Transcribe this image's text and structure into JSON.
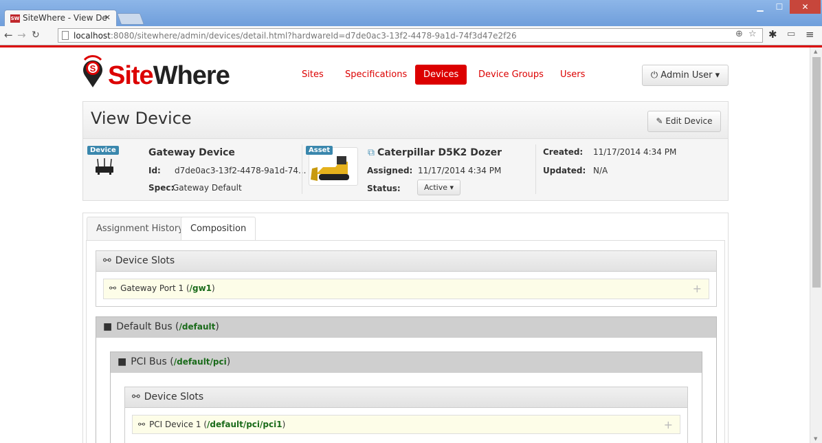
{
  "browser": {
    "tab_title": "SiteWhere - View De",
    "favicon_text": "SW",
    "url_host": "localhost",
    "url_rest": ":8080/sitewhere/admin/devices/detail.html?hardwareId=d7de0ac3-13f2-4478-9a1d-74f3d47e2f26"
  },
  "logo": {
    "site": "Site",
    "where": "Where"
  },
  "nav": {
    "items": [
      {
        "label": "Sites"
      },
      {
        "label": "Specifications"
      },
      {
        "label": "Devices"
      },
      {
        "label": "Device Groups"
      },
      {
        "label": "Users"
      }
    ],
    "active": "Devices",
    "user_label": "Admin User"
  },
  "view": {
    "title": "View Device",
    "edit_label": "Edit Device"
  },
  "device": {
    "badge": "Device",
    "name": "Gateway Device",
    "id_label": "Id:",
    "id_value": "d7de0ac3-13f2-4478-9a1d-74...",
    "spec_label": "Spec:",
    "spec_value": "Gateway Default"
  },
  "asset": {
    "badge": "Asset",
    "name": "Caterpillar D5K2 Dozer",
    "assigned_label": "Assigned:",
    "assigned_value": "11/17/2014 4:34 PM",
    "status_label": "Status:",
    "status_value": "Active"
  },
  "dates": {
    "created_label": "Created:",
    "created_value": "11/17/2014 4:34 PM",
    "updated_label": "Updated:",
    "updated_value": "N/A"
  },
  "tabs": [
    {
      "label": "Assignment History"
    },
    {
      "label": "Composition"
    }
  ],
  "composition": {
    "slots_title": "Device Slots",
    "root_slot": {
      "name": "Gateway Port 1 (",
      "path": "/gw1",
      "close": ")"
    },
    "default_bus": {
      "name": "Default Bus (",
      "path": "/default",
      "close": ")"
    },
    "pci_bus": {
      "name": "PCI Bus (",
      "path": "/default/pci",
      "close": ")"
    },
    "pci_slots_title": "Device Slots",
    "pci_slot": {
      "name": "PCI Device 1 (",
      "path": "/default/pci/pci1",
      "close": ")"
    }
  },
  "colors": {
    "brand": "#dc0000",
    "badge": "#3a87ad",
    "path": "#1a6b1a"
  }
}
